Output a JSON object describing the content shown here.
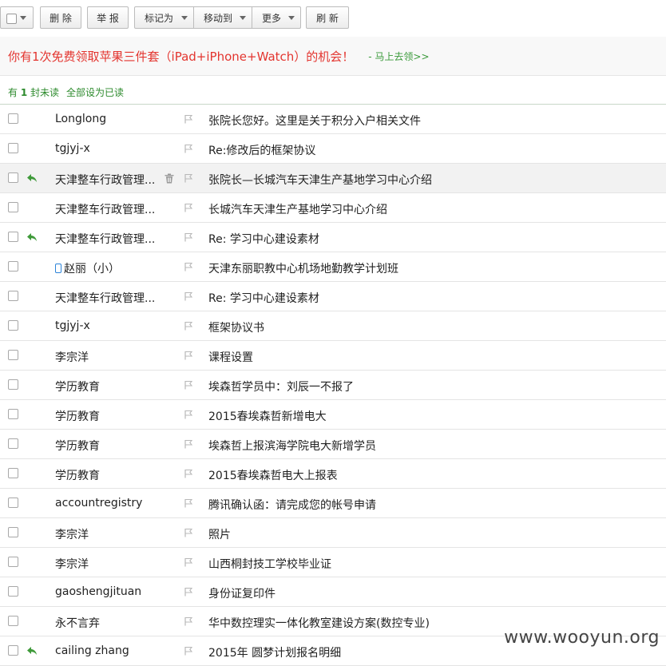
{
  "toolbar": {
    "delete_label": "删 除",
    "report_label": "举 报",
    "mark_label": "标记为",
    "move_label": "移动到",
    "more_label": "更多",
    "refresh_label": "刷 新"
  },
  "promo": {
    "text": "你有1次免费领取苹果三件套（iPad+iPhone+Watch）的机会！",
    "link": "- 马上去领>>"
  },
  "unread_bar": {
    "prefix": "有",
    "count": "1",
    "suffix": "封未读",
    "mark_all_read": "全部设为已读"
  },
  "emails": [
    {
      "sender": "Longlong",
      "subject": "张院长您好。这里是关于积分入户相关文件",
      "replied": false,
      "mobile": false
    },
    {
      "sender": "tgjyj-x",
      "subject": "Re:修改后的框架协议",
      "replied": false,
      "mobile": false
    },
    {
      "sender": "天津整车行政管理...",
      "subject": "张院长—长城汽车天津生产基地学习中心介绍",
      "replied": true,
      "mobile": false,
      "hover": true
    },
    {
      "sender": "天津整车行政管理...",
      "subject": "长城汽车天津生产基地学习中心介绍",
      "replied": false,
      "mobile": false
    },
    {
      "sender": "天津整车行政管理...",
      "subject": "Re: 学习中心建设素材",
      "replied": true,
      "mobile": false
    },
    {
      "sender": "赵丽（小）",
      "subject": "天津东丽职教中心机场地勤教学计划班",
      "replied": false,
      "mobile": true
    },
    {
      "sender": "天津整车行政管理...",
      "subject": "Re: 学习中心建设素材",
      "replied": false,
      "mobile": false
    },
    {
      "sender": "tgjyj-x",
      "subject": "框架协议书",
      "replied": false,
      "mobile": false
    },
    {
      "sender": "李宗洋",
      "subject": "课程设置",
      "replied": false,
      "mobile": false
    },
    {
      "sender": "学历教育",
      "subject": "埃森哲学员中：刘辰一不报了",
      "replied": false,
      "mobile": false
    },
    {
      "sender": "学历教育",
      "subject": "2015春埃森哲新增电大",
      "replied": false,
      "mobile": false
    },
    {
      "sender": "学历教育",
      "subject": "埃森哲上报滨海学院电大新增学员",
      "replied": false,
      "mobile": false
    },
    {
      "sender": "学历教育",
      "subject": "2015春埃森哲电大上报表",
      "replied": false,
      "mobile": false
    },
    {
      "sender": "accountregistry",
      "subject": "腾讯确认函：请完成您的帐号申请",
      "replied": false,
      "mobile": false
    },
    {
      "sender": "李宗洋",
      "subject": "照片",
      "replied": false,
      "mobile": false
    },
    {
      "sender": "李宗洋",
      "subject": "山西桐封技工学校毕业证",
      "replied": false,
      "mobile": false
    },
    {
      "sender": "gaoshengjituan",
      "subject": "身份证复印件",
      "replied": false,
      "mobile": false
    },
    {
      "sender": "永不言弃",
      "subject": "华中数控理实一体化教室建设方案(数控专业)",
      "replied": false,
      "mobile": false
    },
    {
      "sender": "cailing zhang",
      "subject": "2015年 圆梦计划报名明细",
      "replied": true,
      "mobile": false
    }
  ],
  "watermark": "www.wooyun.org",
  "colors": {
    "promo_red": "#e3352f",
    "link_green": "#3a9a3a",
    "reply_green": "#3f9a3a"
  }
}
